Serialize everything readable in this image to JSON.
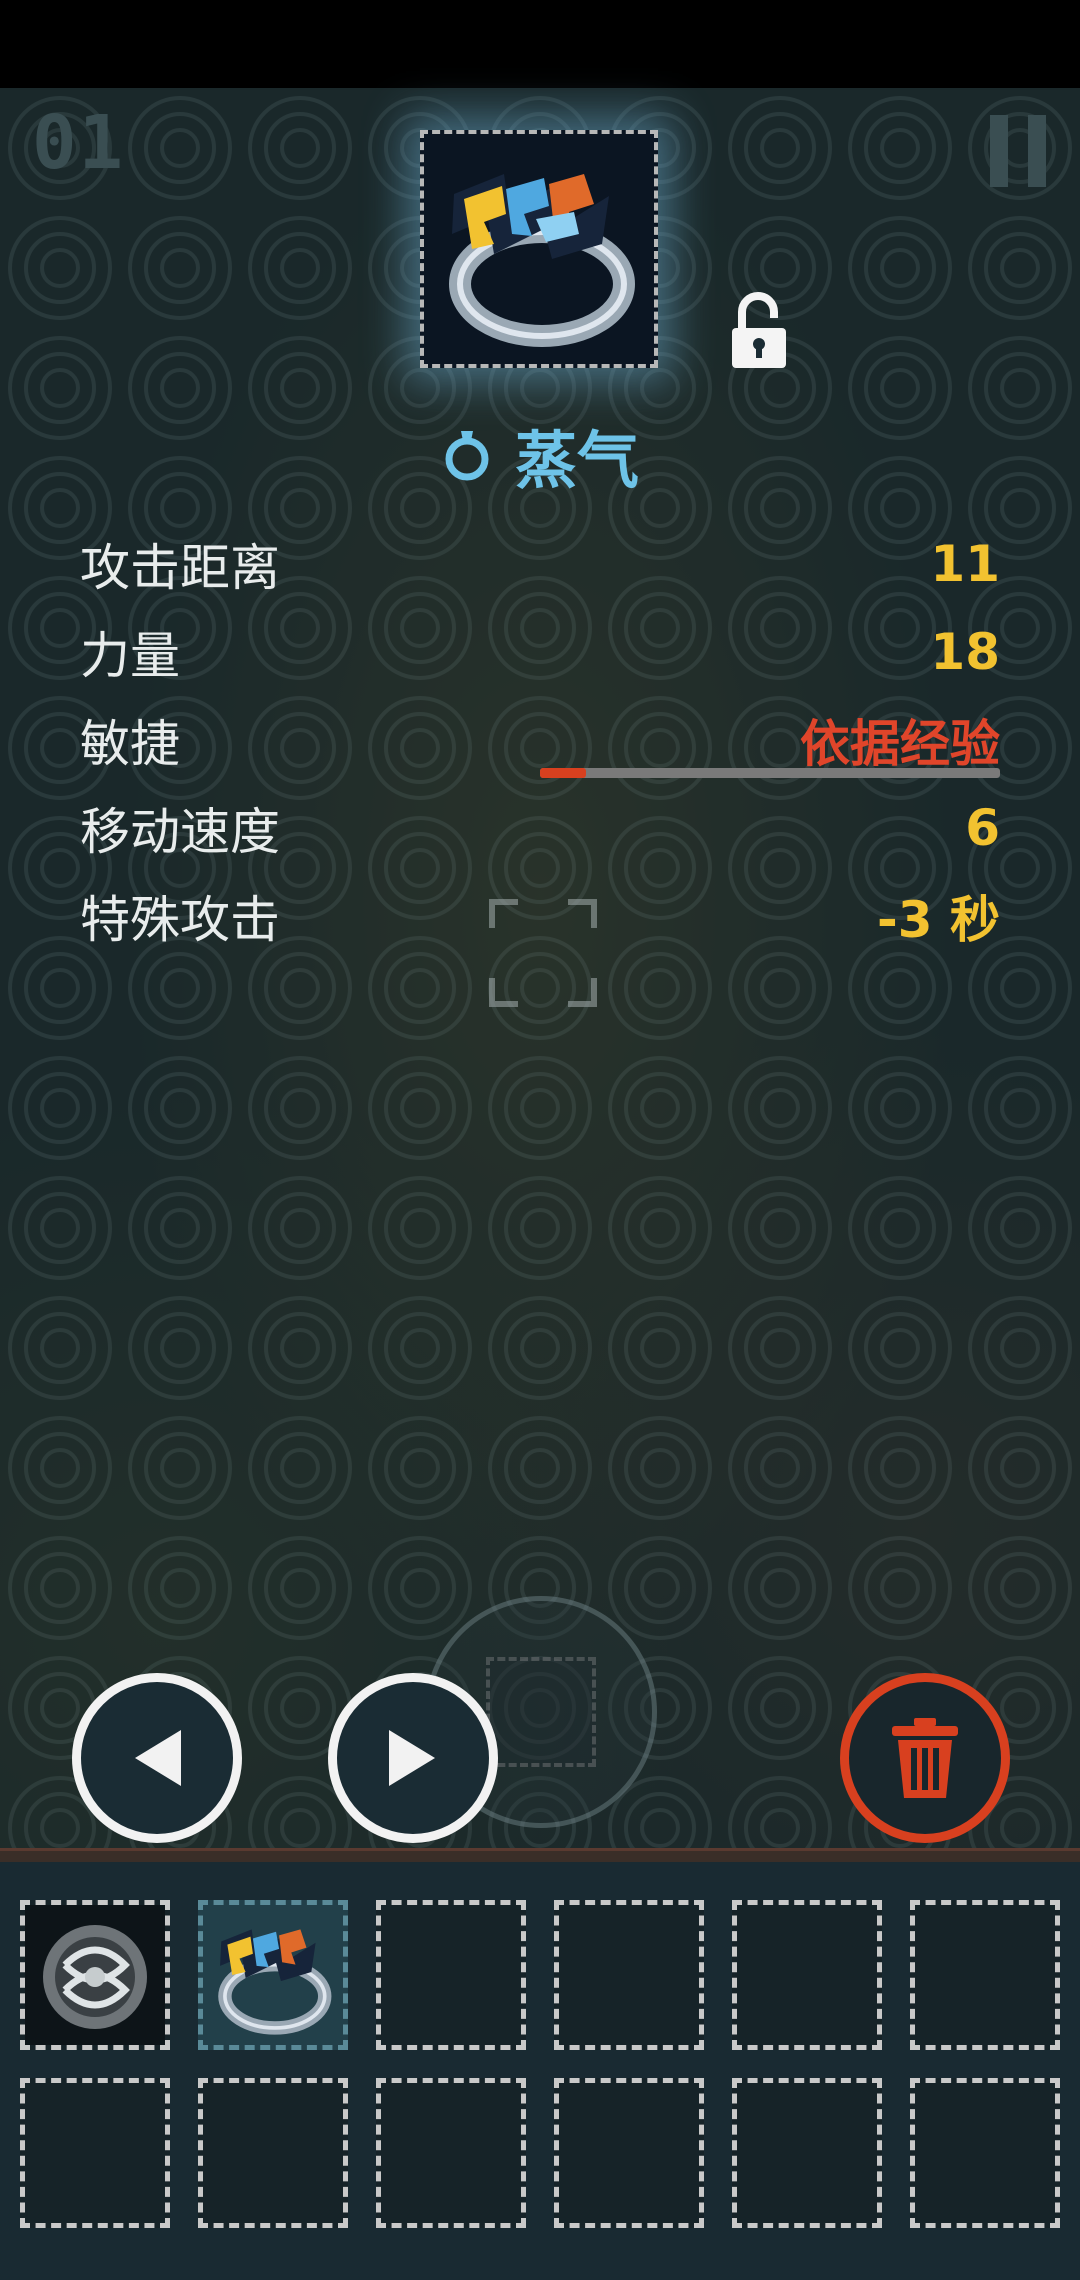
{
  "hud": {
    "level": "01",
    "pause": "pause-icon"
  },
  "item": {
    "name": "蒸气",
    "type_icon": "ring-icon",
    "image_icon": "lightning-ring-icon",
    "lock_icon": "unlocked-padlock-icon",
    "glow_color": "#7ec6ea",
    "name_color": "#6ec3e8"
  },
  "stats": [
    {
      "label": "攻击距离",
      "value": "11"
    },
    {
      "label": "力量",
      "value": "18"
    },
    {
      "label": "敏捷",
      "value": "依据经验"
    },
    {
      "label": "移动速度",
      "value": "6"
    },
    {
      "label": "特殊攻击",
      "value": "-3 秒"
    }
  ],
  "xp_progress": 0.1,
  "colors": {
    "stat_value": "#f2c230",
    "stat_value_alert": "#e0452a",
    "delete_ring": "#d8401f"
  },
  "controls": {
    "prev": "left-triangle-icon",
    "next": "right-triangle-icon",
    "delete": "trash-can-icon"
  },
  "inventory": {
    "rows": 2,
    "columns": 6,
    "slots": [
      {
        "item": "knot-ring-icon",
        "selected": false
      },
      {
        "item": "lightning-ring-icon",
        "selected": true
      },
      {
        "item": "",
        "selected": false
      },
      {
        "item": "",
        "selected": false
      },
      {
        "item": "",
        "selected": false
      },
      {
        "item": "",
        "selected": false
      },
      {
        "item": "",
        "selected": false
      },
      {
        "item": "",
        "selected": false
      },
      {
        "item": "",
        "selected": false
      },
      {
        "item": "",
        "selected": false
      },
      {
        "item": "",
        "selected": false
      },
      {
        "item": "",
        "selected": false
      }
    ]
  }
}
